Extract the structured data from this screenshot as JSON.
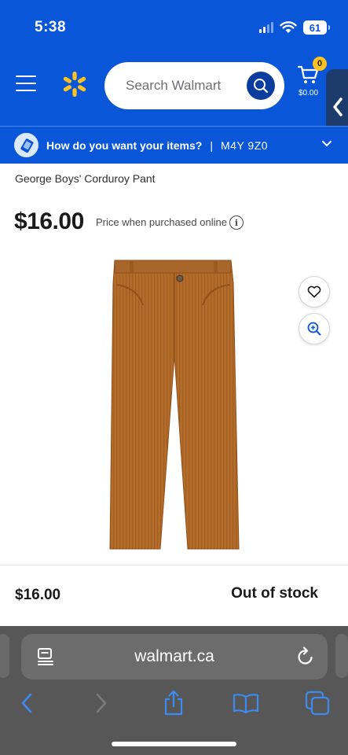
{
  "status_bar": {
    "time": "5:38",
    "battery": "61"
  },
  "header": {
    "search_placeholder": "Search Walmart",
    "cart_count": "0",
    "cart_total": "$0.00",
    "brand_color": "#0a56d9",
    "spark_color": "#ffc220"
  },
  "delivery": {
    "question": "How do you want your items?",
    "separator": "|",
    "postal_code": "M4Y 9Z0"
  },
  "product": {
    "title": "George Boys' Corduroy Pant",
    "price": "$16.00",
    "price_note": "Price when purchased online",
    "info_symbol": "i",
    "image_color": "#b46c2a"
  },
  "footer": {
    "price": "$16.00",
    "stock_status": "Out of stock"
  },
  "browser": {
    "url": "walmart.ca",
    "icons": [
      "back-icon",
      "forward-icon",
      "share-icon",
      "bookmarks-icon",
      "tabs-icon"
    ]
  }
}
